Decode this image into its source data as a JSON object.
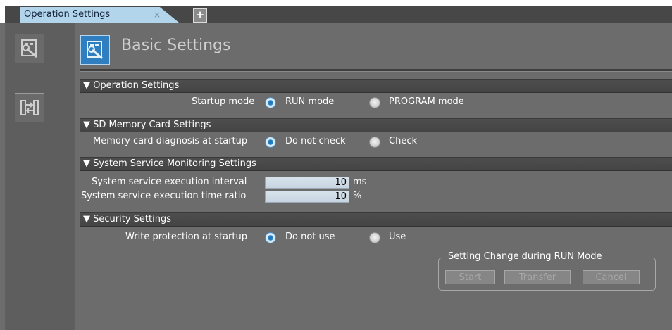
{
  "tabs": [
    {
      "label": "Operation Settings",
      "close": "×"
    }
  ],
  "add_tab_label": "+",
  "header": {
    "title": "Basic Settings"
  },
  "sections": {
    "operation": {
      "title": "▼ Operation Settings",
      "startup_mode_label": "Startup mode",
      "options": [
        "RUN mode",
        "PROGRAM mode"
      ],
      "selected": "RUN mode"
    },
    "sd_card": {
      "title": "▼ SD Memory Card Settings",
      "diagnosis_label": "Memory card diagnosis at startup",
      "options": [
        "Do not check",
        "Check"
      ],
      "selected": "Do not check"
    },
    "system_service": {
      "title": "▼ System Service Monitoring Settings",
      "interval_label": "System service execution interval",
      "interval_value": "10",
      "interval_unit": "ms",
      "ratio_label": "System service execution time ratio",
      "ratio_value": "10",
      "ratio_unit": "%"
    },
    "security": {
      "title": "▼ Security Settings",
      "write_protection_label": "Write protection at startup",
      "options": [
        "Do not use",
        "Use"
      ],
      "selected": "Do not use"
    }
  },
  "run_mode_group": {
    "title": "Setting Change during RUN Mode",
    "buttons": [
      "Start",
      "Transfer",
      "Cancel"
    ]
  },
  "colors": {
    "background": "#6c6c6c",
    "section_bar": "#4a4a4a",
    "tab_active": "#b3d5ec",
    "accent": "#2f7fc0"
  },
  "icons": [
    "basic-settings-icon",
    "transfer-settings-icon",
    "radio-selected",
    "radio-unselected"
  ]
}
